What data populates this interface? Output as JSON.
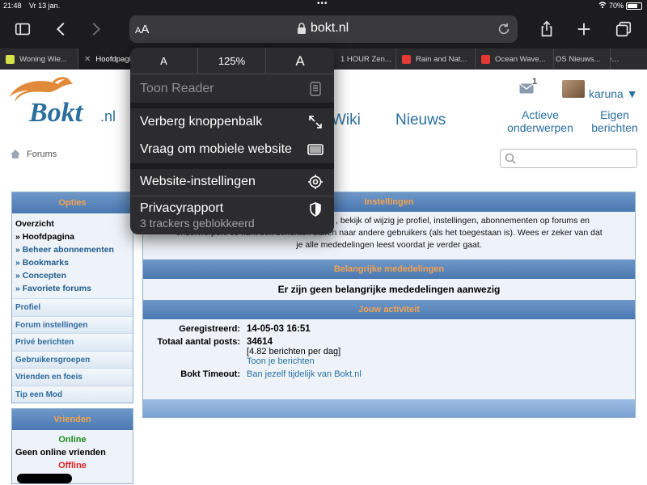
{
  "status_bar": {
    "time": "21:48",
    "date": "Vr 13 jan.",
    "battery": "70%"
  },
  "toolbar": {
    "aa_small": "A",
    "aa_big": "A",
    "domain": "bokt.nl"
  },
  "tabs": [
    {
      "label": "Woning Wie...",
      "favicon_color": "#d7e04b",
      "active": false
    },
    {
      "label": "Hoofdpagina",
      "favicon_color": "#ffffff",
      "active": true
    },
    {
      "label": "1 HOUR Zen...",
      "favicon_color": "#e53935",
      "active": false
    },
    {
      "label": "Rain and Nat...",
      "favicon_color": "#e53935",
      "active": false
    },
    {
      "label": "Ocean Wave...",
      "favicon_color": "#e53935",
      "active": false
    },
    {
      "label": "OS Nieuws...",
      "favicon_color": "#3a3a3c",
      "active": false
    }
  ],
  "popover": {
    "zoom_small": "A",
    "zoom_pct": "125%",
    "zoom_big": "A",
    "reader": "Toon Reader",
    "hide_toolbar": "Verberg knoppenbalk",
    "mobile": "Vraag om mobiele website",
    "settings": "Website-instellingen",
    "privacy": "Privacyrapport",
    "privacy_sub": "3 trackers geblokkeerd"
  },
  "header": {
    "nav_wiki": "Wiki",
    "nav_news": "Nieuws",
    "active_topics_1": "Actieve",
    "active_topics_2": "onderwerpen",
    "own_posts_1": "Eigen",
    "own_posts_2": "berichten",
    "mail_count": "1",
    "username": "karuna ▼"
  },
  "breadcrumb": "Forums",
  "left": {
    "options_title": "Opties",
    "overview_title": "Overzicht",
    "items": [
      "» Hoofdpagina",
      "» Beheer abonnementen",
      "» Bookmarks",
      "» Concepten",
      "» Favoriete forums"
    ],
    "links": [
      "Profiel",
      "Forum instellingen",
      "Privé berichten",
      "Gebruikersgroepen",
      "Vrienden en foeis",
      "Tip een Mod"
    ],
    "friends_title": "Vrienden",
    "online": "Online",
    "no_online": "Geen online vrienden",
    "offline": "Offline"
  },
  "right": {
    "settings_title": "Instellingen",
    "intro_1": ", bekijk of wijzig je profiel, instellingen, abonnementen op forums en",
    "intro_2": "onderwerpen. Je kunt ook berichten sturen naar andere gebruikers (als het toegestaan is). Wees er zeker van dat",
    "intro_3": "je alle mededelingen leest voordat je verder gaat.",
    "announcements_title": "Belangrijke mededelingen",
    "no_announcements": "Er zijn geen belangrijke mededelingen aanwezig",
    "activity_title": "Jouw activiteit",
    "registered_label": "Geregistreerd:",
    "registered_value": "14-05-03 16:51",
    "posts_label": "Totaal aantal posts:",
    "posts_value": "34614",
    "posts_per_day": "[4.82 berichten per dag]",
    "show_posts": "Toon je berichten",
    "timeout_label": "Bokt Timeout:",
    "timeout_value": "Ban jezelf tijdelijk van Bokt.nl"
  }
}
